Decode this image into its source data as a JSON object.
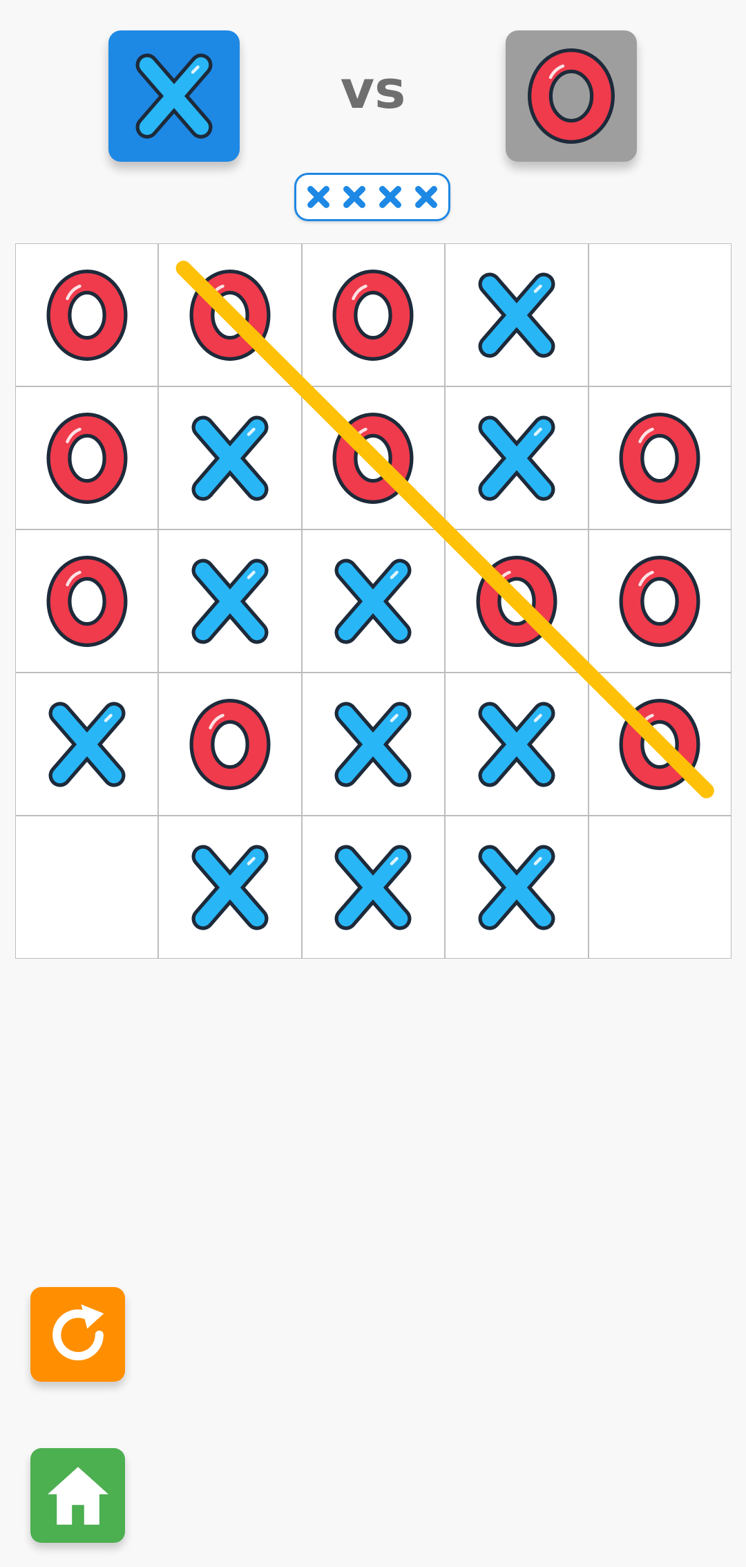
{
  "header": {
    "player_x_symbol": "X",
    "vs_label": "vs",
    "player_o_symbol": "O",
    "active_player": "X",
    "streak_marks": [
      "X",
      "X",
      "X",
      "X"
    ]
  },
  "board": {
    "size": 5,
    "rows": [
      [
        "O",
        "O",
        "O",
        "X",
        ""
      ],
      [
        "O",
        "X",
        "O",
        "X",
        "O"
      ],
      [
        "O",
        "X",
        "X",
        "O",
        "O"
      ],
      [
        "X",
        "O",
        "X",
        "X",
        "O"
      ],
      [
        "",
        "X",
        "X",
        "X",
        ""
      ]
    ],
    "winning_line": {
      "player": "O",
      "from_cell": [
        0,
        1
      ],
      "to_cell": [
        3,
        4
      ]
    }
  },
  "controls": {
    "restart_icon": "restart-icon",
    "home_icon": "home-icon"
  },
  "colors": {
    "x_fill": "#29b6f6",
    "o_fill": "#ef3b4c",
    "mark_outline": "#1d2a3a",
    "x_tile": "#1e88e5",
    "o_tile": "#9e9e9e",
    "win_line": "#ffc107",
    "restart_button": "#ff8f00",
    "home_button": "#4caf50"
  }
}
